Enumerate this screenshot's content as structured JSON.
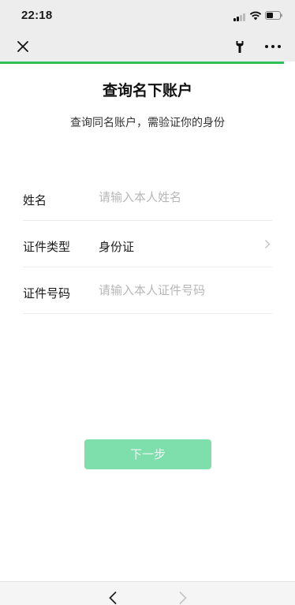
{
  "status_bar": {
    "time": "22:18"
  },
  "navbar": {
    "accent_color": "#2dc156",
    "icons": [
      "close-icon",
      "wrench-icon",
      "more-icon"
    ]
  },
  "page": {
    "title": "查询名下账户",
    "subtitle": "查询同名账户，需验证你的身份"
  },
  "form": {
    "name": {
      "label": "姓名",
      "value": "",
      "placeholder": "请输入本人姓名"
    },
    "id_type": {
      "label": "证件类型",
      "value": "身份证"
    },
    "id_number": {
      "label": "证件号码",
      "value": "",
      "placeholder": "请输入本人证件号码"
    }
  },
  "next_button": {
    "label": "下一步",
    "color": "#7fdfac"
  },
  "bottom_bar": {
    "icons": [
      "back-arrow-icon",
      "forward-arrow-icon"
    ]
  }
}
